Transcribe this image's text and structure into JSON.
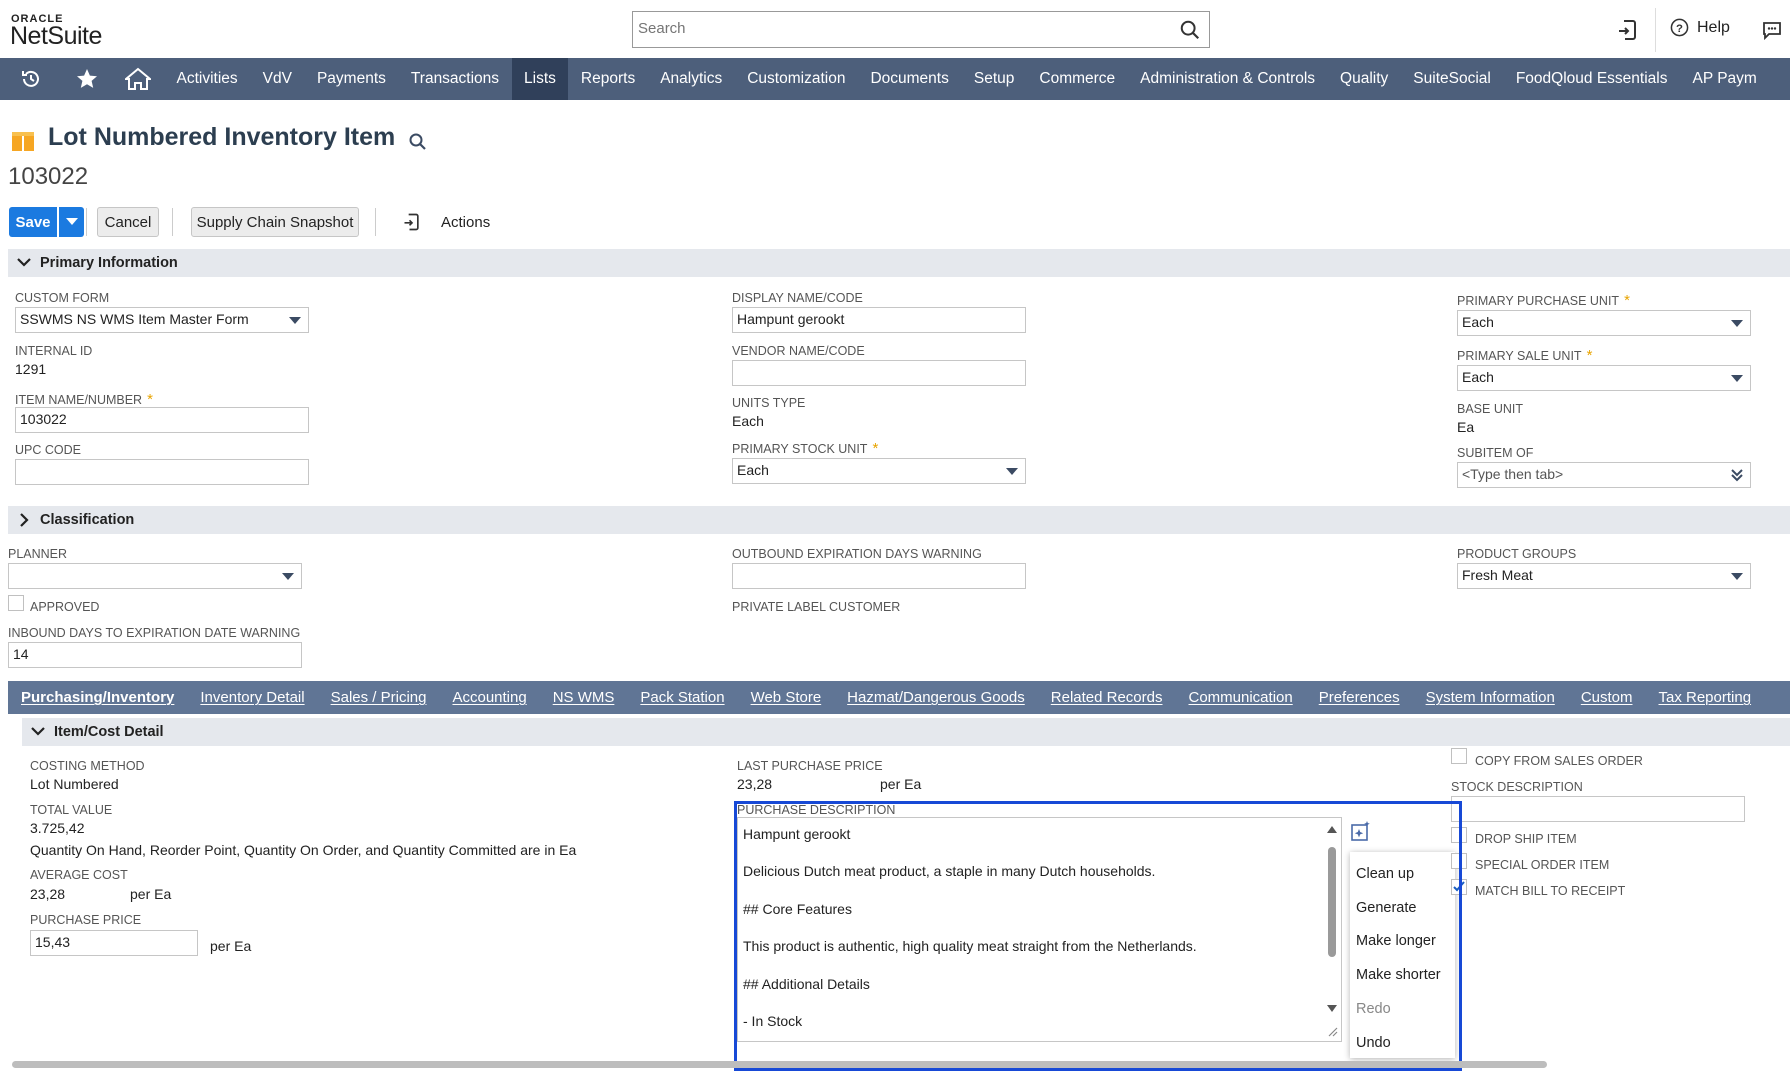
{
  "brand": {
    "oracle": "ORACLE",
    "netsuite": "NetSuite"
  },
  "search": {
    "placeholder": "Search"
  },
  "topbar": {
    "help_label": "Help"
  },
  "nav": {
    "items": [
      "Activities",
      "VdV",
      "Payments",
      "Transactions",
      "Lists",
      "Reports",
      "Analytics",
      "Customization",
      "Documents",
      "Setup",
      "Commerce",
      "Administration & Controls",
      "Quality",
      "SuiteSocial",
      "FoodQloud Essentials",
      "AP Paym"
    ],
    "active": "Lists"
  },
  "page": {
    "title": "Lot Numbered Inventory Item",
    "record_number": "103022"
  },
  "toolbar": {
    "save_label": "Save",
    "cancel_label": "Cancel",
    "snapshot_label": "Supply Chain Snapshot",
    "actions_label": "Actions"
  },
  "primary_info": {
    "header": "Primary Information",
    "custom_form_label": "CUSTOM FORM",
    "custom_form_value": "SSWMS NS WMS Item Master Form",
    "internal_id_label": "INTERNAL ID",
    "internal_id_value": "1291",
    "item_name_label": "ITEM NAME/NUMBER",
    "item_name_value": "103022",
    "upc_label": "UPC CODE",
    "upc_value": "",
    "display_name_label": "DISPLAY NAME/CODE",
    "display_name_value": "Hampunt gerookt",
    "vendor_name_label": "VENDOR NAME/CODE",
    "vendor_name_value": "",
    "units_type_label": "UNITS TYPE",
    "units_type_value": "Each",
    "primary_stock_label": "PRIMARY STOCK UNIT",
    "primary_stock_value": "Each",
    "primary_purchase_label": "PRIMARY PURCHASE UNIT",
    "primary_purchase_value": "Each",
    "primary_sale_label": "PRIMARY SALE UNIT",
    "primary_sale_value": "Each",
    "base_unit_label": "BASE UNIT",
    "base_unit_value": "Ea",
    "subitem_label": "SUBITEM OF",
    "subitem_placeholder": "<Type then tab>"
  },
  "classification": {
    "header": "Classification",
    "planner_label": "PLANNER",
    "planner_value": "",
    "approved_label": "APPROVED",
    "inbound_label": "INBOUND DAYS TO EXPIRATION DATE WARNING",
    "inbound_value": "14",
    "outbound_label": "OUTBOUND EXPIRATION DAYS WARNING",
    "outbound_value": "",
    "private_label_label": "PRIVATE LABEL CUSTOMER",
    "product_groups_label": "PRODUCT GROUPS",
    "product_groups_value": "Fresh Meat"
  },
  "subtabs": {
    "items": [
      "Purchasing/Inventory",
      "Inventory Detail",
      "Sales / Pricing",
      "Accounting",
      "NS WMS",
      "Pack Station",
      "Web Store",
      "Hazmat/Dangerous Goods",
      "Related Records",
      "Communication",
      "Preferences",
      "System Information",
      "Custom",
      "Tax Reporting"
    ],
    "active": "Purchasing/Inventory"
  },
  "item_cost": {
    "header": "Item/Cost Detail",
    "costing_method_label": "COSTING METHOD",
    "costing_method_value": "Lot Numbered",
    "total_value_label": "TOTAL VALUE",
    "total_value_value": "3.725,42",
    "quantity_note": "Quantity On Hand, Reorder Point, Quantity On Order, and Quantity Committed are in Ea",
    "avg_cost_label": "AVERAGE COST",
    "avg_cost_value": "23,28",
    "avg_cost_unit": "per Ea",
    "purchase_price_label": "PURCHASE PRICE",
    "purchase_price_value": "15,43",
    "purchase_price_unit": "per Ea",
    "last_purchase_label": "LAST PURCHASE PRICE",
    "last_purchase_value": "23,28",
    "last_purchase_unit": "per Ea",
    "purchase_desc_label": "PURCHASE DESCRIPTION",
    "purchase_desc_lines": [
      "Hampunt gerookt",
      "Delicious Dutch meat product, a staple in many Dutch households.",
      "## Core Features",
      "This product is authentic, high quality meat straight from the Netherlands.",
      "## Additional Details",
      "- In Stock"
    ],
    "copy_from_sales_label": "COPY FROM SALES ORDER",
    "stock_desc_label": "STOCK DESCRIPTION",
    "stock_desc_value": "",
    "drop_ship_label": "DROP SHIP ITEM",
    "special_order_label": "SPECIAL ORDER ITEM",
    "match_bill_label": "MATCH BILL TO RECEIPT"
  },
  "ai_menu": {
    "items": [
      "Clean up",
      "Generate",
      "Make longer",
      "Make shorter",
      "Redo",
      "Undo"
    ]
  }
}
